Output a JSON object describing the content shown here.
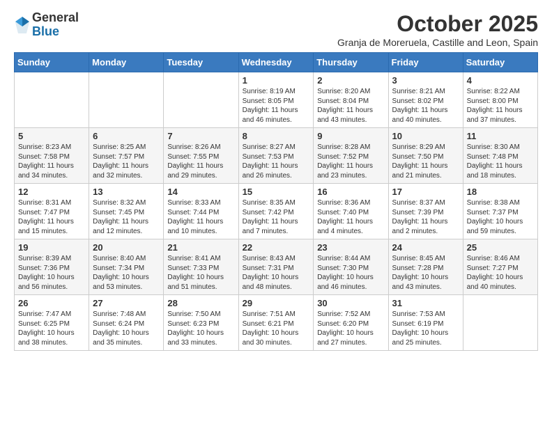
{
  "logo": {
    "general": "General",
    "blue": "Blue"
  },
  "header": {
    "month": "October 2025",
    "location": "Granja de Moreruela, Castille and Leon, Spain"
  },
  "weekdays": [
    "Sunday",
    "Monday",
    "Tuesday",
    "Wednesday",
    "Thursday",
    "Friday",
    "Saturday"
  ],
  "weeks": [
    [
      {
        "day": "",
        "info": ""
      },
      {
        "day": "",
        "info": ""
      },
      {
        "day": "",
        "info": ""
      },
      {
        "day": "1",
        "info": "Sunrise: 8:19 AM\nSunset: 8:05 PM\nDaylight: 11 hours and 46 minutes."
      },
      {
        "day": "2",
        "info": "Sunrise: 8:20 AM\nSunset: 8:04 PM\nDaylight: 11 hours and 43 minutes."
      },
      {
        "day": "3",
        "info": "Sunrise: 8:21 AM\nSunset: 8:02 PM\nDaylight: 11 hours and 40 minutes."
      },
      {
        "day": "4",
        "info": "Sunrise: 8:22 AM\nSunset: 8:00 PM\nDaylight: 11 hours and 37 minutes."
      }
    ],
    [
      {
        "day": "5",
        "info": "Sunrise: 8:23 AM\nSunset: 7:58 PM\nDaylight: 11 hours and 34 minutes."
      },
      {
        "day": "6",
        "info": "Sunrise: 8:25 AM\nSunset: 7:57 PM\nDaylight: 11 hours and 32 minutes."
      },
      {
        "day": "7",
        "info": "Sunrise: 8:26 AM\nSunset: 7:55 PM\nDaylight: 11 hours and 29 minutes."
      },
      {
        "day": "8",
        "info": "Sunrise: 8:27 AM\nSunset: 7:53 PM\nDaylight: 11 hours and 26 minutes."
      },
      {
        "day": "9",
        "info": "Sunrise: 8:28 AM\nSunset: 7:52 PM\nDaylight: 11 hours and 23 minutes."
      },
      {
        "day": "10",
        "info": "Sunrise: 8:29 AM\nSunset: 7:50 PM\nDaylight: 11 hours and 21 minutes."
      },
      {
        "day": "11",
        "info": "Sunrise: 8:30 AM\nSunset: 7:48 PM\nDaylight: 11 hours and 18 minutes."
      }
    ],
    [
      {
        "day": "12",
        "info": "Sunrise: 8:31 AM\nSunset: 7:47 PM\nDaylight: 11 hours and 15 minutes."
      },
      {
        "day": "13",
        "info": "Sunrise: 8:32 AM\nSunset: 7:45 PM\nDaylight: 11 hours and 12 minutes."
      },
      {
        "day": "14",
        "info": "Sunrise: 8:33 AM\nSunset: 7:44 PM\nDaylight: 11 hours and 10 minutes."
      },
      {
        "day": "15",
        "info": "Sunrise: 8:35 AM\nSunset: 7:42 PM\nDaylight: 11 hours and 7 minutes."
      },
      {
        "day": "16",
        "info": "Sunrise: 8:36 AM\nSunset: 7:40 PM\nDaylight: 11 hours and 4 minutes."
      },
      {
        "day": "17",
        "info": "Sunrise: 8:37 AM\nSunset: 7:39 PM\nDaylight: 11 hours and 2 minutes."
      },
      {
        "day": "18",
        "info": "Sunrise: 8:38 AM\nSunset: 7:37 PM\nDaylight: 10 hours and 59 minutes."
      }
    ],
    [
      {
        "day": "19",
        "info": "Sunrise: 8:39 AM\nSunset: 7:36 PM\nDaylight: 10 hours and 56 minutes."
      },
      {
        "day": "20",
        "info": "Sunrise: 8:40 AM\nSunset: 7:34 PM\nDaylight: 10 hours and 53 minutes."
      },
      {
        "day": "21",
        "info": "Sunrise: 8:41 AM\nSunset: 7:33 PM\nDaylight: 10 hours and 51 minutes."
      },
      {
        "day": "22",
        "info": "Sunrise: 8:43 AM\nSunset: 7:31 PM\nDaylight: 10 hours and 48 minutes."
      },
      {
        "day": "23",
        "info": "Sunrise: 8:44 AM\nSunset: 7:30 PM\nDaylight: 10 hours and 46 minutes."
      },
      {
        "day": "24",
        "info": "Sunrise: 8:45 AM\nSunset: 7:28 PM\nDaylight: 10 hours and 43 minutes."
      },
      {
        "day": "25",
        "info": "Sunrise: 8:46 AM\nSunset: 7:27 PM\nDaylight: 10 hours and 40 minutes."
      }
    ],
    [
      {
        "day": "26",
        "info": "Sunrise: 7:47 AM\nSunset: 6:25 PM\nDaylight: 10 hours and 38 minutes."
      },
      {
        "day": "27",
        "info": "Sunrise: 7:48 AM\nSunset: 6:24 PM\nDaylight: 10 hours and 35 minutes."
      },
      {
        "day": "28",
        "info": "Sunrise: 7:50 AM\nSunset: 6:23 PM\nDaylight: 10 hours and 33 minutes."
      },
      {
        "day": "29",
        "info": "Sunrise: 7:51 AM\nSunset: 6:21 PM\nDaylight: 10 hours and 30 minutes."
      },
      {
        "day": "30",
        "info": "Sunrise: 7:52 AM\nSunset: 6:20 PM\nDaylight: 10 hours and 27 minutes."
      },
      {
        "day": "31",
        "info": "Sunrise: 7:53 AM\nSunset: 6:19 PM\nDaylight: 10 hours and 25 minutes."
      },
      {
        "day": "",
        "info": ""
      }
    ]
  ]
}
